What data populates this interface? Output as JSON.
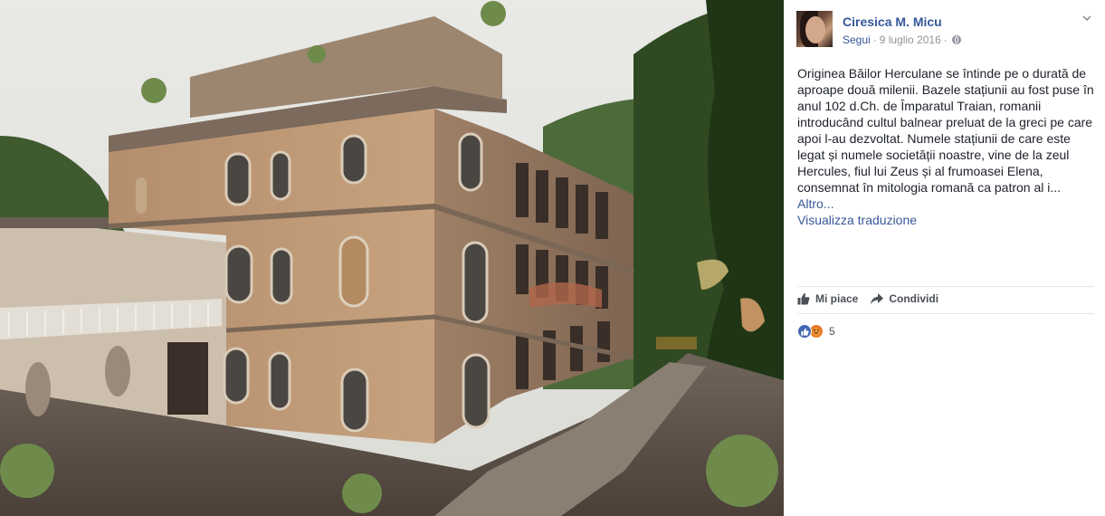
{
  "post": {
    "author": "Ciresica M. Micu",
    "follow_label": "Segui",
    "separator": "·",
    "date": "9 luglio 2016",
    "text": "Originea Băilor Herculane se întinde pe o durată de aproape două milenii. Bazele stațiunii au fost puse în anul 102 d.Ch. de Împaratul Traian, romanii introducând cultul balnear preluat de la greci pe care apoi l-au dezvoltat. Numele stațiunii de care este legat și numele societății noastre, vine de la zeul Hercules, fiul lui Zeus și al frumoasei Elena, consemnat în mitologia romană ca patron al i...",
    "more_label": "Altro...",
    "translate_label": "Visualizza traduzione"
  },
  "actions": {
    "like_label": "Mi piace",
    "share_label": "Condividi"
  },
  "reactions": {
    "count": "5",
    "types": [
      "like",
      "angry"
    ]
  },
  "icons": {
    "privacy": "globe-icon",
    "options": "chevron-down-icon",
    "like": "thumbs-up-icon",
    "share": "share-arrow-icon"
  },
  "colors": {
    "link": "#365899",
    "meta": "#90949c",
    "text": "#1d2129",
    "like_reaction": "#4267b2",
    "angry_reaction": "#e9710f"
  }
}
